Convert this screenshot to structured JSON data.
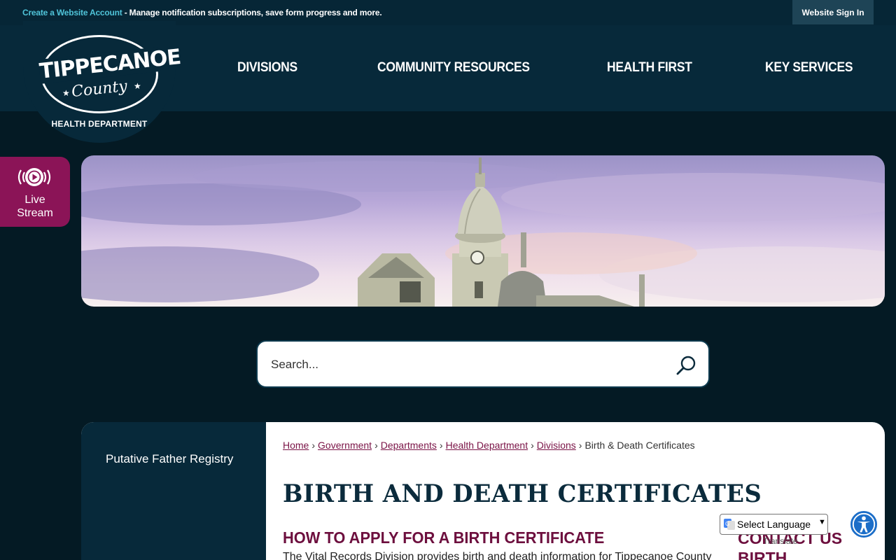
{
  "topbar": {
    "create_link": "Create a Website Account",
    "message": " - Manage notification subscriptions, save form progress and more.",
    "signin_label": "Website Sign In"
  },
  "logo": {
    "title": "TIPPECANOE",
    "county": "County",
    "department": "HEALTH DEPARTMENT"
  },
  "nav": {
    "items": [
      "DIVISIONS",
      "COMMUNITY RESOURCES",
      "HEALTH FIRST",
      "KEY SERVICES"
    ]
  },
  "livestream": {
    "line1": "Live",
    "line2": "Stream",
    "icon": "live-stream-play-icon"
  },
  "search": {
    "placeholder": "Search...",
    "icon": "search-icon"
  },
  "sidebar": {
    "items": [
      "Putative Father Registry"
    ]
  },
  "breadcrumb": {
    "links": [
      "Home",
      "Government",
      "Departments",
      "Health Department",
      "Divisions"
    ],
    "current": "Birth & Death Certificates",
    "separator": "›"
  },
  "main": {
    "title": "BIRTH AND DEATH CERTIFICATES",
    "subtitle": "HOW TO APPLY FOR A BIRTH CERTIFICATE",
    "intro": "The Vital Records Division provides birth and death information for Tippecanoe County",
    "contact_heading": "CONTACT US",
    "contact_sub": "BIRTH"
  },
  "translate": {
    "label": "Select Language",
    "powered_by": "Translate"
  },
  "colors": {
    "brand_dark": "#07293a",
    "accent_magenta": "#8b1457",
    "link_maroon": "#7a1346",
    "top_link": "#4fc3d8"
  }
}
